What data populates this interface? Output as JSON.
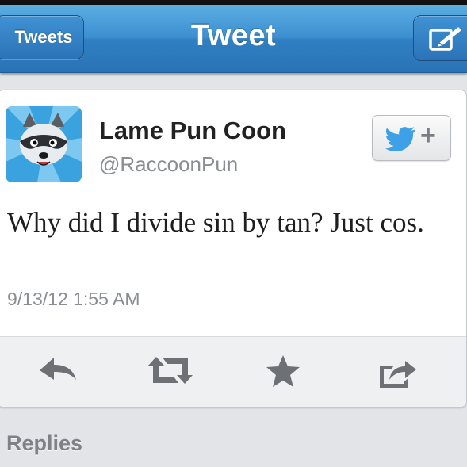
{
  "nav": {
    "back_label": "Tweets",
    "title": "Tweet",
    "compose_icon": "compose-icon"
  },
  "tweet": {
    "display_name": "Lame Pun Coon",
    "handle": "@RaccoonPun",
    "text": "Why did I divide sin by tan? Just cos.",
    "timestamp": "9/13/12 1:55 AM",
    "avatar_icon": "raccoon-avatar",
    "follow_button": {
      "icon": "twitter-bird-icon",
      "plus": "+"
    }
  },
  "actions": [
    {
      "name": "reply",
      "icon": "reply-icon"
    },
    {
      "name": "retweet",
      "icon": "retweet-icon"
    },
    {
      "name": "favorite",
      "icon": "star-icon"
    },
    {
      "name": "share",
      "icon": "share-icon"
    }
  ],
  "replies": {
    "label": "Replies"
  },
  "colors": {
    "nav_blue": "#2f7fc3",
    "icon_gray": "#6d7075",
    "text_dark": "#222222",
    "text_gray": "#8a8d91"
  }
}
